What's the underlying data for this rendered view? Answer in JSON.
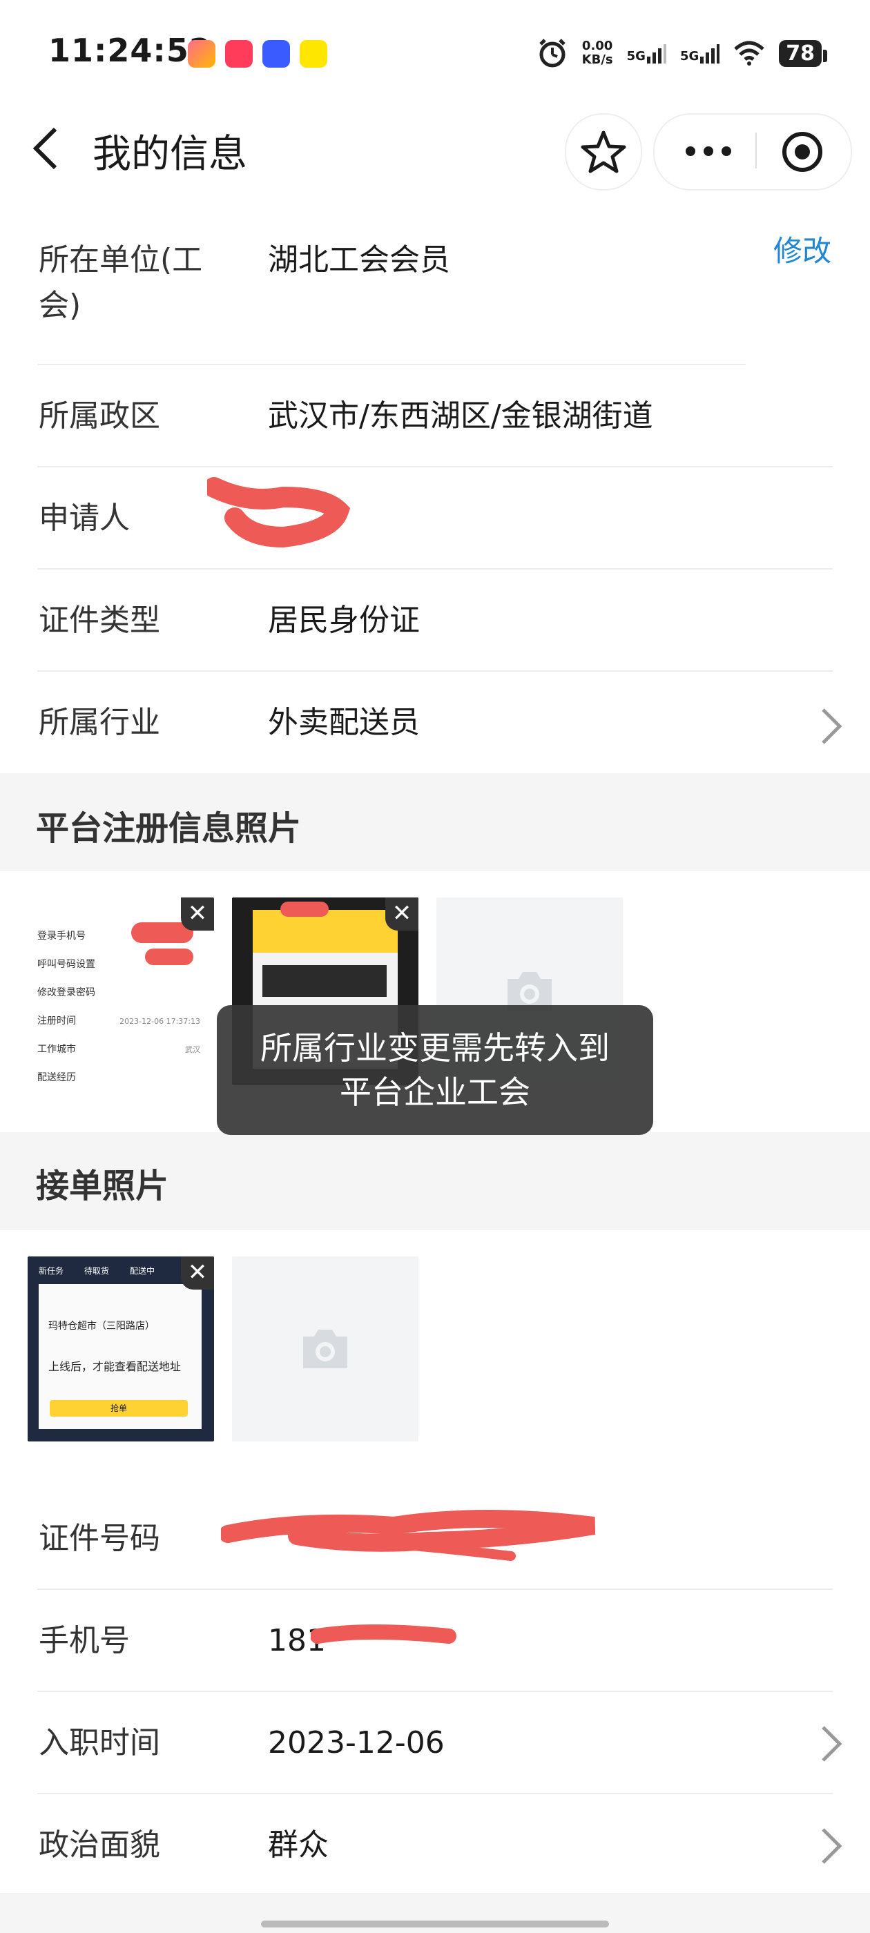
{
  "status_bar": {
    "time": "11:24:52",
    "net_speed_value": "0.00",
    "net_speed_unit": "KB/s",
    "sig1": "5G",
    "sig2": "5G",
    "battery": "78"
  },
  "nav": {
    "title": "我的信息"
  },
  "edit_label": "修改",
  "rows_top": [
    {
      "label_line1": "所在单位(工",
      "label_line2": "会)",
      "value": "湖北工会会员"
    },
    {
      "label": "所属政区",
      "value": "武汉市/东西湖区/金银湖街道"
    },
    {
      "label": "申请人",
      "value": ""
    },
    {
      "label": "证件类型",
      "value": "居民身份证"
    },
    {
      "label": "所属行业",
      "value": "外卖配送员"
    }
  ],
  "section_platform": "平台注册信息照片",
  "platform_photo_menu": [
    "登录手机号",
    "呼叫号码设置",
    "修改登录密码",
    "注册时间",
    "工作城市",
    "配送经历"
  ],
  "platform_photo_time": "2023-12-06 17:37:13",
  "platform_photo_city": "武汉",
  "toast": {
    "line1": "所属行业变更需先转入到",
    "line2": "平台企业工会"
  },
  "section_orders": "接单照片",
  "order_photo": {
    "tabs": [
      "新任务",
      "待取货",
      "配送中"
    ],
    "store": "玛特仓超市（三阳路店）",
    "notice": "上线后，才能查看配送地址",
    "button": "抢单"
  },
  "rows_bottom": [
    {
      "label": "证件号码",
      "value": ""
    },
    {
      "label": "手机号",
      "value": "181"
    },
    {
      "label": "入职时间",
      "value": "2023-12-06"
    },
    {
      "label": "政治面貌",
      "value": "群众"
    }
  ],
  "colors": {
    "accent": "#1f87d6",
    "redact": "#ee5a55"
  },
  "icons": [
    "back-icon",
    "star-icon",
    "more-icon",
    "target-icon",
    "chevron-right-icon",
    "camera-icon",
    "close-icon"
  ]
}
